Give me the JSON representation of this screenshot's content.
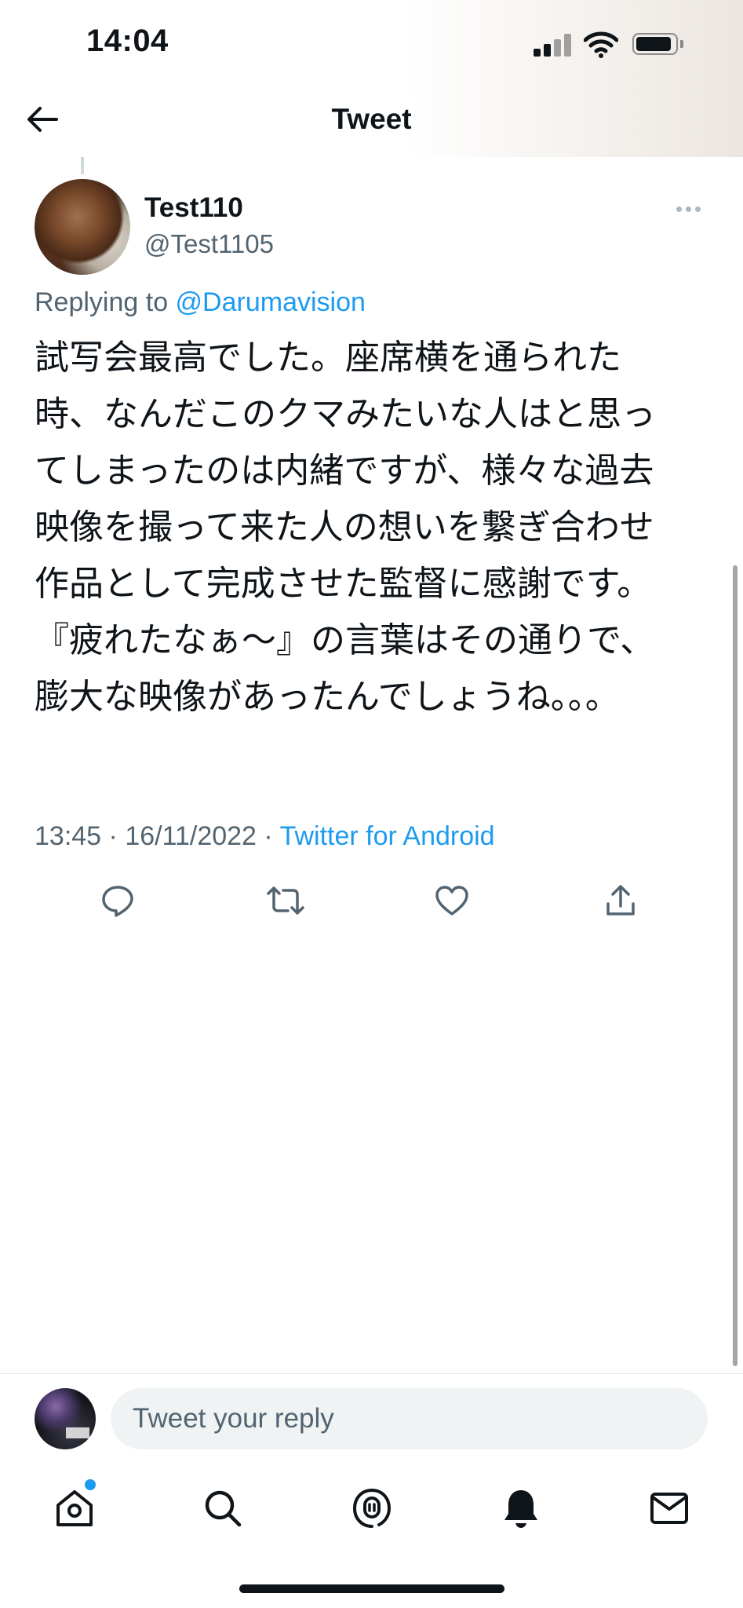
{
  "status_bar": {
    "time": "14:04"
  },
  "header": {
    "title": "Tweet"
  },
  "tweet": {
    "display_name": "Test110",
    "username": "@Test1105",
    "replying_prefix": "Replying to ",
    "replying_to": "@Darumavision",
    "text_lines": [
      "試写会最高でした。座席横を通られた",
      "時、なんだこのクマみたいな人はと思っ",
      "てしまったのは内緒ですが、様々な過去",
      "映像を撮って来た人の想いを繋ぎ合わせ",
      "作品として完成させた監督に感謝です。",
      "『疲れたなぁ〜』の言葉はその通りで、",
      "膨大な映像があったんでしょうね。。。"
    ],
    "time": "13:45",
    "separator": " · ",
    "date": "16/11/2022",
    "source": "Twitter for Android"
  },
  "actions": {
    "icons": [
      "reply-icon",
      "retweet-icon",
      "like-icon",
      "share-icon"
    ]
  },
  "composer": {
    "placeholder": "Tweet your reply"
  },
  "bottom_nav": {
    "icons": [
      "home-icon",
      "search-icon",
      "spaces-icon",
      "notifications-icon",
      "messages-icon"
    ]
  },
  "colors": {
    "accent": "#1d9bf0",
    "text_primary": "#0f1419",
    "text_secondary": "#536471",
    "input_bg": "#eff3f4"
  }
}
